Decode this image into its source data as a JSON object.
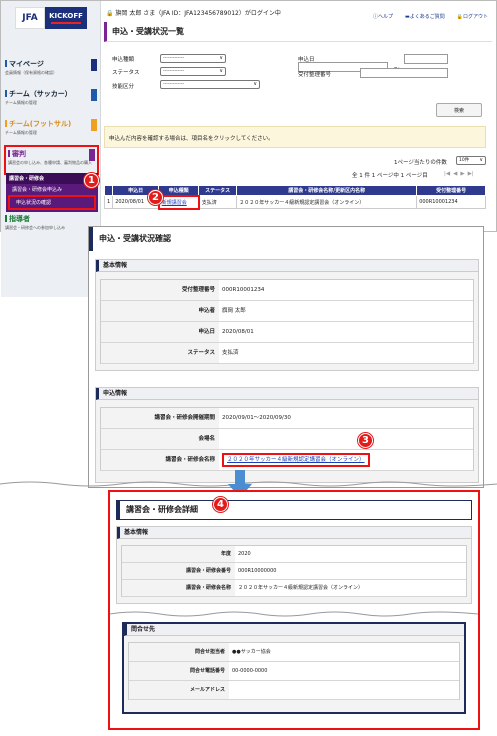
{
  "header": {
    "user_line": "旗岡 太郎 さま（JFA ID：JFA123456789012）がログイン中",
    "help": "ヘルプ",
    "faq": "よくあるご質問",
    "logout": "ログアウト"
  },
  "logo": {
    "jfa": "JFA",
    "kickoff": "KICKOFF"
  },
  "sidebar": {
    "mypage": {
      "label": "マイページ",
      "sub": "会員情報（保有資格の確認）"
    },
    "team_soccer": {
      "label": "チーム（サッカー）",
      "sub": "チーム情報の管理"
    },
    "team_futsal": {
      "label": "チーム(フットサル)",
      "sub": "チーム情報の管理"
    },
    "apply": {
      "label": "審判",
      "sub": "講習会の申し込み、各種申請、審判物品の購入"
    },
    "sub_section": "講習会・研修会",
    "sub_items": [
      "講習会・研修会申込み",
      "申込状況の確認"
    ],
    "coach": {
      "label": "指導者",
      "sub": "講習会・研修会への参加申し込み"
    }
  },
  "page1": {
    "title": "申込・受講状況一覧",
    "form": {
      "type_label": "申込種類",
      "status_label": "ステータス",
      "tech_label": "技能区分",
      "date_label": "申込日",
      "receipt_label": "受付整理番号",
      "select_placeholder": "-------------",
      "range_sep": "〜"
    },
    "search_button": "検索",
    "notice": "申込んだ内容を確認する場合は、項目名をクリックしてください。",
    "per_page_label": "1ページ当たりの件数",
    "per_page_value": "10件",
    "paging_text": "全 1 件 1 ページ中 1 ページ目",
    "pager_arrows": [
      "|◀",
      "◀",
      "▶",
      "▶|"
    ],
    "table": {
      "headers": [
        "申込日",
        "申込種類",
        "ステータス",
        "講習会・研修会名称/更新区内名称",
        "受付整理番号"
      ],
      "rows": [
        {
          "no": "1",
          "date": "2020/08/01",
          "type": "新規講習会",
          "status": "支払済",
          "name": "２０２０年サッカー４級新規認定講習会（オンライン）",
          "receipt": "000R10001234"
        }
      ]
    }
  },
  "page2": {
    "title": "申込・受講状況確認",
    "basic_section": "基本情報",
    "basic": [
      {
        "k": "受付整理番号",
        "v": "000R10001234"
      },
      {
        "k": "申込者",
        "v": "旗岡 太郎"
      },
      {
        "k": "申込日",
        "v": "2020/08/01"
      },
      {
        "k": "ステータス",
        "v": "支払済"
      }
    ],
    "apply_section": "申込情報",
    "apply": [
      {
        "k": "講習会・研修会開催期間",
        "v": "2020/09/01〜2020/09/30"
      },
      {
        "k": "会場名",
        "v": ""
      },
      {
        "k": "講習会・研修会名称",
        "v": "２０２０年サッカー４級新規認定講習会（オンライン）"
      }
    ]
  },
  "page3": {
    "title": "講習会・研修会詳細",
    "basic_section": "基本情報",
    "basic": [
      {
        "k": "年度",
        "v": "2020"
      },
      {
        "k": "講習会・研修会番号",
        "v": "000R10000000"
      },
      {
        "k": "講習会・研修会名称",
        "v": "２０２０年サッカー４級新規認定講習会（オンライン）"
      }
    ],
    "contact_section": "問合せ先",
    "contact": [
      {
        "k": "問合せ担当者",
        "v": "●●サッカー協会"
      },
      {
        "k": "問合せ電話番号",
        "v": "00-0000-0000"
      },
      {
        "k": "メールアドレス",
        "v": ""
      }
    ]
  },
  "callouts": [
    "1",
    "2",
    "3",
    "4"
  ],
  "colors": {
    "accent": "#e21b1b",
    "navy": "#1c2b5a",
    "purple": "#5a1a7c",
    "table_header": "#2f3a8f",
    "link": "#1a3fb5"
  }
}
